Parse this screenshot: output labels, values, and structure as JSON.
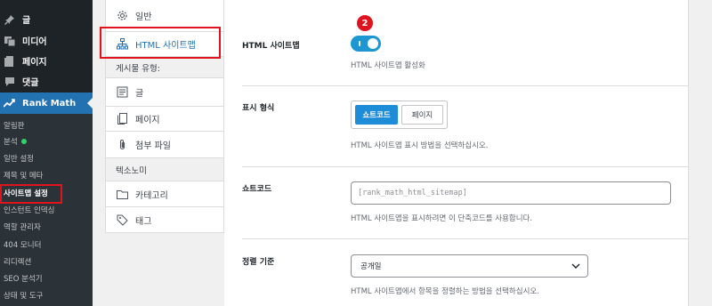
{
  "sidebar": {
    "menu": [
      {
        "label": "글",
        "icon": "pin-icon"
      },
      {
        "label": "미디어",
        "icon": "media-icon"
      },
      {
        "label": "페이지",
        "icon": "page-icon"
      },
      {
        "label": "댓글",
        "icon": "comment-icon"
      },
      {
        "label": "Rank Math",
        "icon": "rank-math-icon"
      }
    ],
    "submenu": [
      {
        "label": "알림판"
      },
      {
        "label": "분석"
      },
      {
        "label": "일반 설정"
      },
      {
        "label": "제목 및 메타"
      },
      {
        "label": "사이트맵 설정"
      },
      {
        "label": "인스턴트 인덱싱"
      },
      {
        "label": "역할 관리자"
      },
      {
        "label": "404 모니터"
      },
      {
        "label": "리디렉션"
      },
      {
        "label": "SEO 분석기"
      },
      {
        "label": "상태 및 도구"
      }
    ]
  },
  "settings_nav": {
    "items": [
      {
        "label": "일반",
        "icon": "gear-icon"
      },
      {
        "label": "HTML 사이트맵",
        "icon": "sitemap-icon"
      },
      {
        "label": "게시물 유형:"
      },
      {
        "label": "글",
        "icon": "post-icon"
      },
      {
        "label": "페이지",
        "icon": "page-icon"
      },
      {
        "label": "첨부 파일",
        "icon": "paperclip-icon"
      },
      {
        "label": "텍소노미"
      },
      {
        "label": "카테고리",
        "icon": "folder-icon"
      },
      {
        "label": "태그",
        "icon": "tag-icon"
      }
    ]
  },
  "badge": "2",
  "fields": {
    "html_sitemap": {
      "label": "HTML 사이트맵",
      "desc": "HTML 사이트맵 활성화",
      "enabled": true
    },
    "display_format": {
      "label": "표시 형식",
      "options": [
        "쇼트코드",
        "페이지"
      ],
      "selected": "쇼트코드",
      "desc": "HTML 사이트맵 표시 방법을 선택하십시오."
    },
    "shortcode": {
      "label": "쇼트코드",
      "value": "[rank_math_html_sitemap]",
      "desc": "HTML 사이트맵을 표시하려면 이 단축코드를 사용합니다."
    },
    "sort_by": {
      "label": "정렬 기준",
      "value": "공개일",
      "desc": "HTML 사이트맵에서 항목을 정렬하는 방법을 선택하십시오."
    }
  },
  "colors": {
    "accent": "#2271b1",
    "toggle": "#1e96d2",
    "highlight": "#e0141e"
  }
}
